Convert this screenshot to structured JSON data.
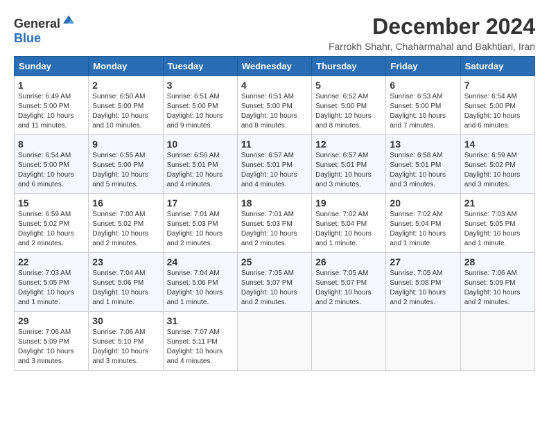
{
  "header": {
    "logo_general": "General",
    "logo_blue": "Blue",
    "month_title": "December 2024",
    "subtitle": "Farrokh Shahr, Chaharmahal and Bakhtiari, Iran"
  },
  "weekdays": [
    "Sunday",
    "Monday",
    "Tuesday",
    "Wednesday",
    "Thursday",
    "Friday",
    "Saturday"
  ],
  "weeks": [
    [
      {
        "day": "1",
        "sunrise": "6:49 AM",
        "sunset": "5:00 PM",
        "daylight": "10 hours and 11 minutes."
      },
      {
        "day": "2",
        "sunrise": "6:50 AM",
        "sunset": "5:00 PM",
        "daylight": "10 hours and 10 minutes."
      },
      {
        "day": "3",
        "sunrise": "6:51 AM",
        "sunset": "5:00 PM",
        "daylight": "10 hours and 9 minutes."
      },
      {
        "day": "4",
        "sunrise": "6:51 AM",
        "sunset": "5:00 PM",
        "daylight": "10 hours and 8 minutes."
      },
      {
        "day": "5",
        "sunrise": "6:52 AM",
        "sunset": "5:00 PM",
        "daylight": "10 hours and 8 minutes."
      },
      {
        "day": "6",
        "sunrise": "6:53 AM",
        "sunset": "5:00 PM",
        "daylight": "10 hours and 7 minutes."
      },
      {
        "day": "7",
        "sunrise": "6:54 AM",
        "sunset": "5:00 PM",
        "daylight": "10 hours and 6 minutes."
      }
    ],
    [
      {
        "day": "8",
        "sunrise": "6:54 AM",
        "sunset": "5:00 PM",
        "daylight": "10 hours and 6 minutes."
      },
      {
        "day": "9",
        "sunrise": "6:55 AM",
        "sunset": "5:00 PM",
        "daylight": "10 hours and 5 minutes."
      },
      {
        "day": "10",
        "sunrise": "6:56 AM",
        "sunset": "5:01 PM",
        "daylight": "10 hours and 4 minutes."
      },
      {
        "day": "11",
        "sunrise": "6:57 AM",
        "sunset": "5:01 PM",
        "daylight": "10 hours and 4 minutes."
      },
      {
        "day": "12",
        "sunrise": "6:57 AM",
        "sunset": "5:01 PM",
        "daylight": "10 hours and 3 minutes."
      },
      {
        "day": "13",
        "sunrise": "6:58 AM",
        "sunset": "5:01 PM",
        "daylight": "10 hours and 3 minutes."
      },
      {
        "day": "14",
        "sunrise": "6:59 AM",
        "sunset": "5:02 PM",
        "daylight": "10 hours and 3 minutes."
      }
    ],
    [
      {
        "day": "15",
        "sunrise": "6:59 AM",
        "sunset": "5:02 PM",
        "daylight": "10 hours and 2 minutes."
      },
      {
        "day": "16",
        "sunrise": "7:00 AM",
        "sunset": "5:02 PM",
        "daylight": "10 hours and 2 minutes."
      },
      {
        "day": "17",
        "sunrise": "7:01 AM",
        "sunset": "5:03 PM",
        "daylight": "10 hours and 2 minutes."
      },
      {
        "day": "18",
        "sunrise": "7:01 AM",
        "sunset": "5:03 PM",
        "daylight": "10 hours and 2 minutes."
      },
      {
        "day": "19",
        "sunrise": "7:02 AM",
        "sunset": "5:04 PM",
        "daylight": "10 hours and 1 minute."
      },
      {
        "day": "20",
        "sunrise": "7:02 AM",
        "sunset": "5:04 PM",
        "daylight": "10 hours and 1 minute."
      },
      {
        "day": "21",
        "sunrise": "7:03 AM",
        "sunset": "5:05 PM",
        "daylight": "10 hours and 1 minute."
      }
    ],
    [
      {
        "day": "22",
        "sunrise": "7:03 AM",
        "sunset": "5:05 PM",
        "daylight": "10 hours and 1 minute."
      },
      {
        "day": "23",
        "sunrise": "7:04 AM",
        "sunset": "5:06 PM",
        "daylight": "10 hours and 1 minute."
      },
      {
        "day": "24",
        "sunrise": "7:04 AM",
        "sunset": "5:06 PM",
        "daylight": "10 hours and 1 minute."
      },
      {
        "day": "25",
        "sunrise": "7:05 AM",
        "sunset": "5:07 PM",
        "daylight": "10 hours and 2 minutes."
      },
      {
        "day": "26",
        "sunrise": "7:05 AM",
        "sunset": "5:07 PM",
        "daylight": "10 hours and 2 minutes."
      },
      {
        "day": "27",
        "sunrise": "7:05 AM",
        "sunset": "5:08 PM",
        "daylight": "10 hours and 2 minutes."
      },
      {
        "day": "28",
        "sunrise": "7:06 AM",
        "sunset": "5:09 PM",
        "daylight": "10 hours and 2 minutes."
      }
    ],
    [
      {
        "day": "29",
        "sunrise": "7:06 AM",
        "sunset": "5:09 PM",
        "daylight": "10 hours and 3 minutes."
      },
      {
        "day": "30",
        "sunrise": "7:06 AM",
        "sunset": "5:10 PM",
        "daylight": "10 hours and 3 minutes."
      },
      {
        "day": "31",
        "sunrise": "7:07 AM",
        "sunset": "5:11 PM",
        "daylight": "10 hours and 4 minutes."
      },
      null,
      null,
      null,
      null
    ]
  ]
}
